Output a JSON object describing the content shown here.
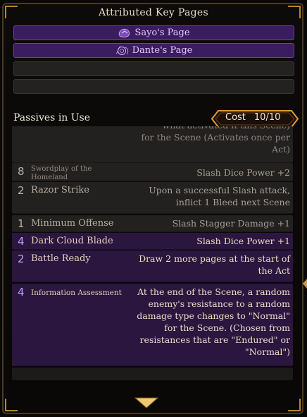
{
  "key_pages": {
    "title": "Attributed Key Pages",
    "slots": [
      {
        "label": "Sayo's Page",
        "icon": "sayo-sigil-icon"
      },
      {
        "label": "Dante's Page",
        "icon": "dante-sigil-icon"
      },
      {
        "label": ""
      },
      {
        "label": ""
      }
    ]
  },
  "passives": {
    "title": "Passives in Use",
    "cost_label": "Cost",
    "cost_value": "10/10",
    "partial_desc": "what activated it this Scene)\nfor the Scene (Activates once per\nAct)",
    "items": [
      {
        "cost": "8",
        "name": "Swordplay of the Homeland",
        "desc": "Slash Dice Power +2",
        "style": "grey"
      },
      {
        "cost": "2",
        "name": "Razor Strike",
        "desc": "Upon a successful Slash attack, inflict 1 Bleed next Scene",
        "style": "grey"
      },
      {
        "cost": "1",
        "name": "Minimum Offense",
        "desc": "Slash Stagger Damage +1",
        "style": "grey"
      },
      {
        "cost": "4",
        "name": "Dark Cloud Blade",
        "desc": "Slash Dice Power +1",
        "style": "purple"
      },
      {
        "cost": "2",
        "name": "Battle Ready",
        "desc": "Draw 2 more pages at the start of the Act",
        "style": "purple"
      },
      {
        "cost": "4",
        "name": "Information Assessment",
        "desc": "At the end of the Scene, a random enemy's resistance to a random damage type changes to \"Normal\" for the Scene. (Chosen from resistances that are \"Endured\" or \"Normal\")",
        "style": "purple"
      }
    ]
  },
  "colors": {
    "accent_gold": "#d8a142",
    "purple_row": "#2b163f",
    "key_page_purple": "#3a1d5e"
  }
}
